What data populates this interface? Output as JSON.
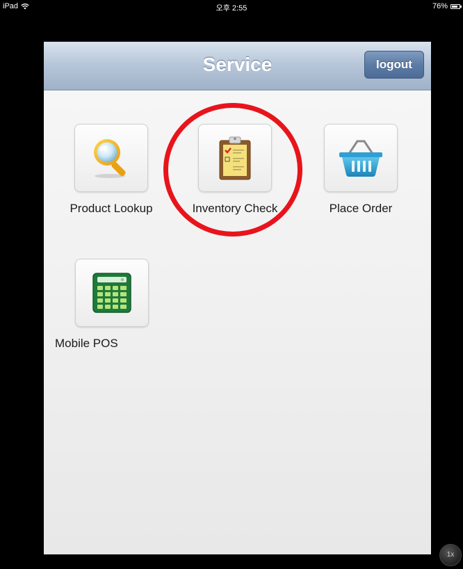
{
  "status_bar": {
    "device": "iPad",
    "time": "오후 2:55",
    "battery": "76%"
  },
  "nav": {
    "title": "Service",
    "logout_label": "logout"
  },
  "menu": {
    "items": [
      {
        "label": "Product Lookup",
        "icon": "magnifier-icon"
      },
      {
        "label": "Inventory Check",
        "icon": "clipboard-icon"
      },
      {
        "label": "Place Order",
        "icon": "basket-icon"
      },
      {
        "label": "Mobile POS",
        "icon": "calculator-icon"
      }
    ]
  },
  "zoom_badge": "1x",
  "colors": {
    "annotation": "#e8141c",
    "nav_bar": "#b8c7da",
    "logout_button": "#5d7ca5"
  }
}
